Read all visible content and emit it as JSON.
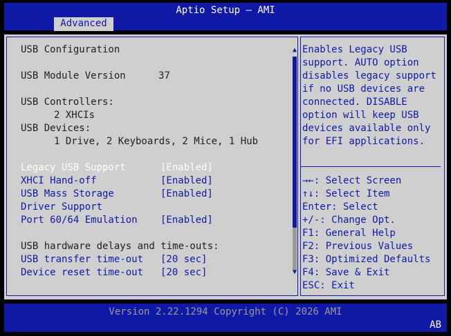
{
  "header": {
    "title": "Aptio Setup – AMI",
    "tabs": [
      "Advanced"
    ]
  },
  "main": {
    "section_title": "USB Configuration",
    "module_version_label": "USB Module Version",
    "module_version_value": "37",
    "controllers_label": "USB Controllers:",
    "controllers_value": "2 XHCIs",
    "devices_label": "USB Devices:",
    "devices_value": "1 Drive, 2 Keyboards, 2 Mice, 1 Hub",
    "settings": [
      {
        "label": "Legacy USB Support",
        "value": "[Enabled]"
      },
      {
        "label": "XHCI Hand-off",
        "value": "[Enabled]"
      },
      {
        "label": "USB Mass Storage",
        "value": "[Enabled]"
      },
      {
        "label": "Driver Support",
        "value": ""
      },
      {
        "label": "Port 60/64 Emulation",
        "value": "[Enabled]"
      }
    ],
    "delays_label": "USB hardware delays and time-outs:",
    "timeouts": [
      {
        "label": "USB transfer time-out",
        "value": "[20 sec]"
      },
      {
        "label": "Device reset time-out",
        "value": "[20 sec]"
      }
    ]
  },
  "help": {
    "lines": [
      "Enables Legacy USB",
      "support. AUTO option",
      "disables legacy support",
      "if no USB devices are",
      "connected. DISABLE",
      "option will keep USB",
      "devices available only",
      "for EFI applications."
    ],
    "keys": [
      "→←: Select Screen",
      "↑↓: Select Item",
      "Enter: Select",
      "+/-: Change Opt.",
      "F1: General Help",
      "F2: Previous Values",
      "F3: Optimized Defaults",
      "F4: Save & Exit",
      "ESC: Exit"
    ]
  },
  "footer": {
    "version": "Version 2.22.1294 Copyright (C) 2026 AMI",
    "corner": "AB"
  },
  "scroll": {
    "up_icon": "▲",
    "down_icon": "▼"
  },
  "colors": {
    "bar": "#1018a6",
    "panel": "#cfcfcf",
    "selected": "#ffffff"
  }
}
